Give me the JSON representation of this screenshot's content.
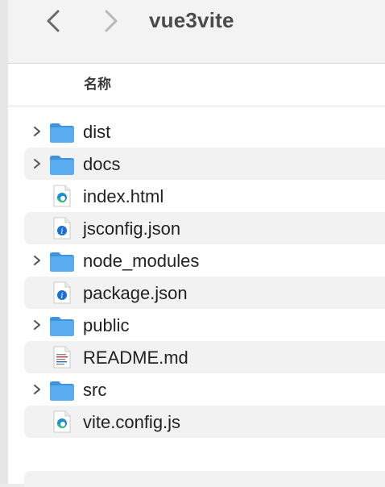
{
  "window": {
    "title": "vue3vite"
  },
  "toolbar": {
    "back_icon": "chevron-left-icon",
    "forward_icon": "chevron-right-icon"
  },
  "list": {
    "column_header": "名称",
    "items": [
      {
        "name": "dist",
        "kind": "folder"
      },
      {
        "name": "docs",
        "kind": "folder"
      },
      {
        "name": "index.html",
        "kind": "edge-file"
      },
      {
        "name": "jsconfig.json",
        "kind": "json-file"
      },
      {
        "name": "node_modules",
        "kind": "folder"
      },
      {
        "name": "package.json",
        "kind": "json-file"
      },
      {
        "name": "public",
        "kind": "folder"
      },
      {
        "name": "README.md",
        "kind": "text-file"
      },
      {
        "name": "src",
        "kind": "folder"
      },
      {
        "name": "vite.config.js",
        "kind": "edge-file"
      }
    ]
  },
  "colors": {
    "folder": "#5aacf0",
    "folder_tab": "#3f93dd",
    "json_badge": "#1c6fd6",
    "alt_row": "#f2f2f2"
  }
}
